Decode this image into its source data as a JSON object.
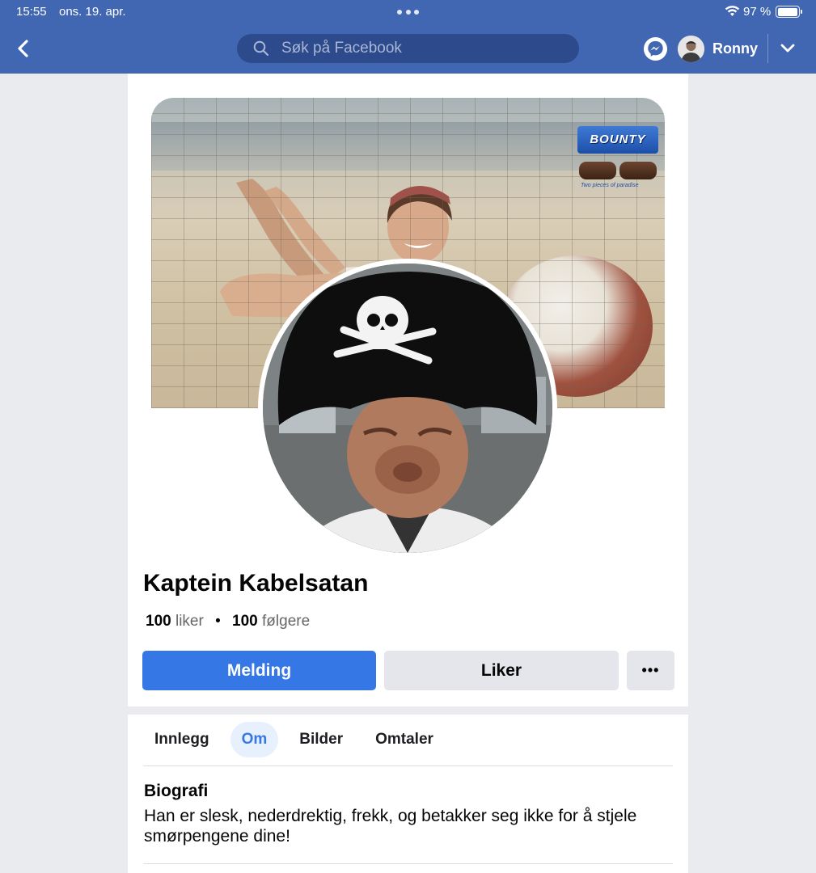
{
  "status_bar": {
    "time": "15:55",
    "date": "ons. 19. apr.",
    "battery": "97 %",
    "battery_level": 0.97
  },
  "header": {
    "back_icon": "chevron-left-icon",
    "search_placeholder": "Søk på Facebook",
    "messenger_icon": "messenger-icon",
    "user_name": "Ronny",
    "menu_icon": "chevron-down-icon"
  },
  "profile": {
    "cover_brand": "BOUNTY",
    "cover_tagline": "Two pieces of paradise",
    "name": "Kaptein Kabelsatan",
    "likes_count": "100",
    "likes_label": "liker",
    "followers_count": "100",
    "followers_label": "følgere",
    "separator": "•"
  },
  "actions": {
    "message_label": "Melding",
    "like_label": "Liker",
    "more_label": "•••"
  },
  "tabs": [
    {
      "label": "Innlegg",
      "active": false
    },
    {
      "label": "Om",
      "active": true
    },
    {
      "label": "Bilder",
      "active": false
    },
    {
      "label": "Omtaler",
      "active": false
    }
  ],
  "about": {
    "bio_title": "Biografi",
    "bio_text": "Han er slesk, nederdrektig, frekk, og betakker seg ikke for å stjele smørpengene dine!"
  },
  "colors": {
    "topbar": "#4267b2",
    "primary_button": "#3578e5",
    "active_tab_bg": "#e7f0fd"
  }
}
